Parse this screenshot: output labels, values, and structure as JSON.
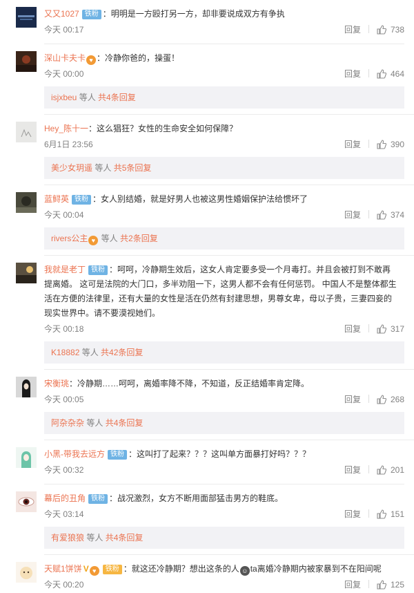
{
  "ui": {
    "reply_label": "回复",
    "sub_middle": " 等人 "
  },
  "comments": [
    {
      "user": "又又1027",
      "badge": "铁粉",
      "text": "：明明是一方殴打另一方，却非要说成双方有争执",
      "time": "今天 00:17",
      "likes": "738",
      "avatar_text": "PHOTO"
    },
    {
      "user": "深山卡夫卡",
      "text": "：冷静你爸的，操蛋！",
      "time": "今天 00:00",
      "likes": "464",
      "sub": {
        "user": "isjxbeu",
        "count": "共4条回复"
      }
    },
    {
      "user": "Hey_陈十一",
      "text": "：这么猖狂？女性的生命安全如何保障？",
      "time": "6月1日 23:56",
      "likes": "390",
      "sub": {
        "user": "美少女玥遥",
        "count": "共5条回复"
      }
    },
    {
      "user": "蓝鲟英",
      "badge": "铁粉",
      "text": "：女人别结婚，就是好男人也被这男性婚姻保护法给惯坏了",
      "time": "今天 00:04",
      "likes": "374",
      "sub": {
        "user": "rivers公主",
        "count": "共2条回复"
      }
    },
    {
      "user": "我就是老丁",
      "badge": "铁粉",
      "text": "：呵呵，冷静期生效后，这女人肯定要多受一个月毒打。并且会被打到不敢再提离婚。 这可是法院的大门口，多半劝阻一下，这男人都不会有任何惩罚。 中国人不是整体都生活在方便的法律里，还有大量的女性是活在仍然有封建思想，男尊女卑，母以子贵，三妻四妾的现实世界中。请不要漠视她们。",
      "time": "今天 00:18",
      "likes": "317",
      "sub": {
        "user": "K18882",
        "count": "共42条回复"
      }
    },
    {
      "user": "宋衡珧",
      "text": "：冷静期……呵呵，离婚率降不降，不知道，反正结婚率肯定降。",
      "time": "今天 00:05",
      "likes": "268",
      "sub": {
        "user": "阿杂杂杂",
        "count": "共4条回复"
      }
    },
    {
      "user": "小黑-带我去远方",
      "badge": "铁粉",
      "text": "：这叫打了起来？？？这叫单方面暴打好吗？？？",
      "time": "今天 00:32",
      "likes": "201"
    },
    {
      "user": "幕后的丑角",
      "badge": "铁粉",
      "text": "：战况激烈，女方不断用面部猛击男方的鞋底。",
      "time": "今天 03:14",
      "likes": "151",
      "sub": {
        "user": "有爱狼狼",
        "count": "共4条回复"
      }
    },
    {
      "user": "天赋1饼饼",
      "badge": "铁粉",
      "text": "：就这还冷静期？想出这条的人",
      "text2": "ta离婚冷静期内被家暴到不在阳间呢",
      "time": "今天 00:20",
      "likes": "125"
    }
  ]
}
